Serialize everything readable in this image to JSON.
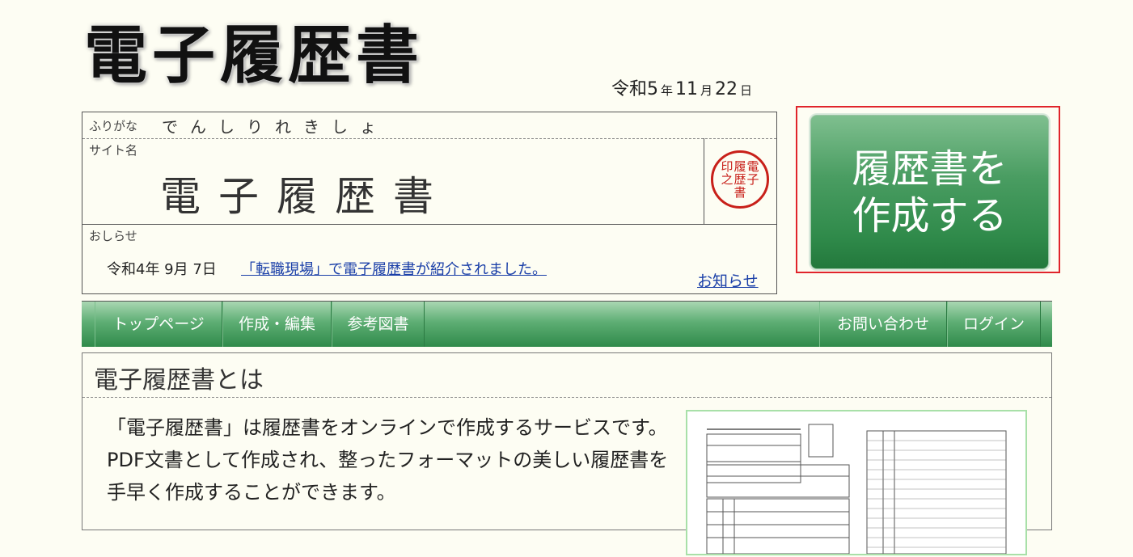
{
  "header": {
    "logo_text": "電子履歴書",
    "date": {
      "era_year": "令和5",
      "year_unit": "年",
      "month": "11",
      "month_unit": "月",
      "day": "22",
      "day_unit": "日"
    }
  },
  "card": {
    "furigana_label": "ふりがな",
    "furigana": "でんしりれきしょ",
    "site_name_label": "サイト名",
    "site_name": "電子履歴書",
    "seal_chars": [
      "履",
      "電",
      "子",
      "之",
      "歴",
      "書",
      "印",
      "",
      ""
    ],
    "notice_label": "おしらせ",
    "notice_date": "令和4年 9月 7日",
    "notice_link": "「転職現場」で電子履歴書が紹介されました。",
    "notice_more": "お知らせ"
  },
  "cta": {
    "line1": "履歴書を",
    "line2": "作成する"
  },
  "nav": {
    "left": [
      "トップページ",
      "作成・編集",
      "参考図書"
    ],
    "right": [
      "お問い合わせ",
      "ログイン"
    ]
  },
  "content": {
    "title": "電子履歴書とは",
    "body": "「電子履歴書」は履歴書をオンラインで作成するサービスです。PDF文書として作成され、整ったフォーマットの美しい履歴書を手早く作成することができます。"
  },
  "colors": {
    "nav_green": "#2f8a4a",
    "cta_green": "#4a9d62",
    "seal_red": "#c8201a",
    "highlight_red": "#e0242b",
    "link_blue": "#1a3fa8"
  }
}
